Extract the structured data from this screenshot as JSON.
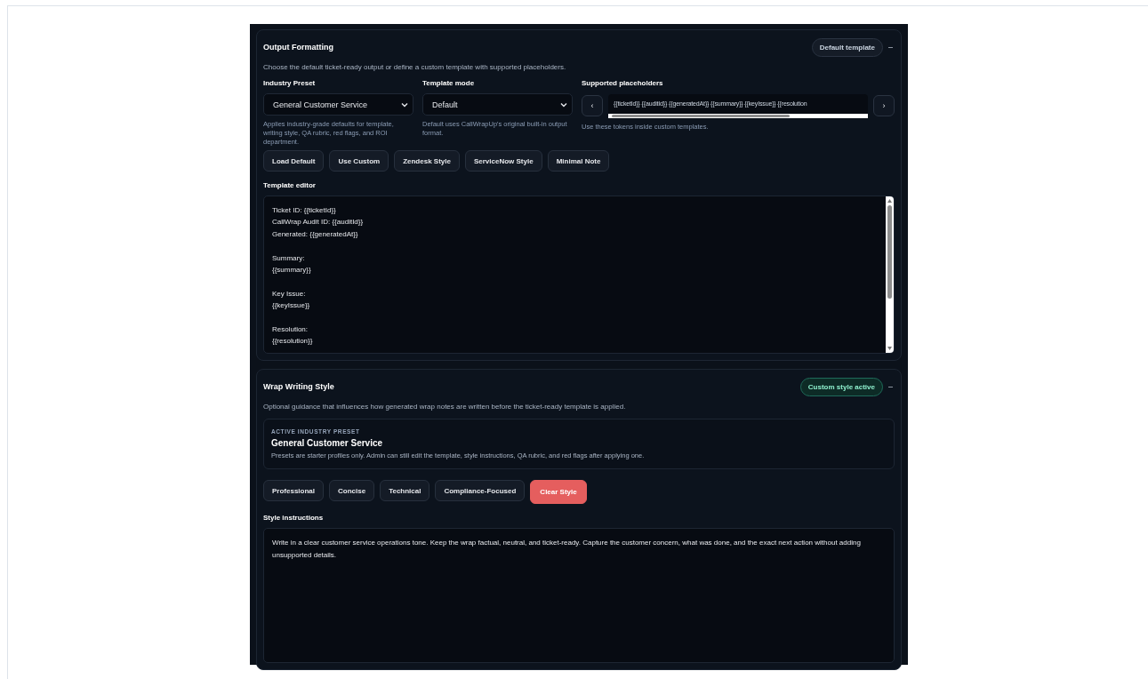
{
  "output_formatting": {
    "title": "Output Formatting",
    "badge": {
      "label": "Default template",
      "kind": "neutral"
    },
    "collapse": "–",
    "description": "Choose the default ticket-ready output or define a custom template with supported placeholders.",
    "industry_preset": {
      "label": "Industry Preset",
      "value": "General Customer Service",
      "help": "Applies industry-grade defaults for template, writing style, QA rubric, red flags, and ROI department."
    },
    "template_mode": {
      "label": "Template mode",
      "value": "Default",
      "help": "Default uses CallWrapUp's original built-in output format."
    },
    "placeholders": {
      "label": "Supported placeholders",
      "prev": "‹",
      "next": "›",
      "value": "{{ticketId}} {{auditId}} {{generatedAt}} {{summary}} {{keyIssue}} {{resolution",
      "help": "Use these tokens inside custom templates."
    },
    "buttons": [
      {
        "label": "Load Default",
        "kind": "default"
      },
      {
        "label": "Use Custom",
        "kind": "default"
      },
      {
        "label": "Zendesk Style",
        "kind": "default"
      },
      {
        "label": "ServiceNow Style",
        "kind": "default"
      },
      {
        "label": "Minimal Note",
        "kind": "default"
      }
    ],
    "template_editor": {
      "label": "Template editor",
      "blocks": [
        [
          "Ticket ID: {{ticketId}}",
          "CallWrap Audit ID: {{auditId}}",
          "Generated: {{generatedAt}}"
        ],
        [
          "Summary:",
          "{{summary}}"
        ],
        [
          "Key Issue:",
          "{{keyIssue}}"
        ],
        [
          "Resolution:",
          "{{resolution}}"
        ]
      ]
    }
  },
  "wrap_writing_style": {
    "title": "Wrap Writing Style",
    "badge": {
      "label": "Custom style active",
      "kind": "active"
    },
    "collapse": "–",
    "description": "Optional guidance that influences how generated wrap notes are written before the ticket-ready template is applied.",
    "active_preset": {
      "eyebrow": "ACTIVE INDUSTRY PRESET",
      "name": "General Customer Service",
      "note": "Presets are starter profiles only. Admin can still edit the template, style instructions, QA rubric, and red flags after applying one."
    },
    "buttons": [
      {
        "label": "Professional",
        "kind": "default"
      },
      {
        "label": "Concise",
        "kind": "default"
      },
      {
        "label": "Technical",
        "kind": "default"
      },
      {
        "label": "Compliance-Focused",
        "kind": "default"
      },
      {
        "label": "Clear Style",
        "kind": "danger"
      }
    ],
    "style_instructions": {
      "label": "Style instructions",
      "value": "Write in a clear customer service operations tone. Keep the wrap factual, neutral, and ticket-ready. Capture the customer concern, what was done, and the exact next action without adding unsupported details."
    }
  }
}
